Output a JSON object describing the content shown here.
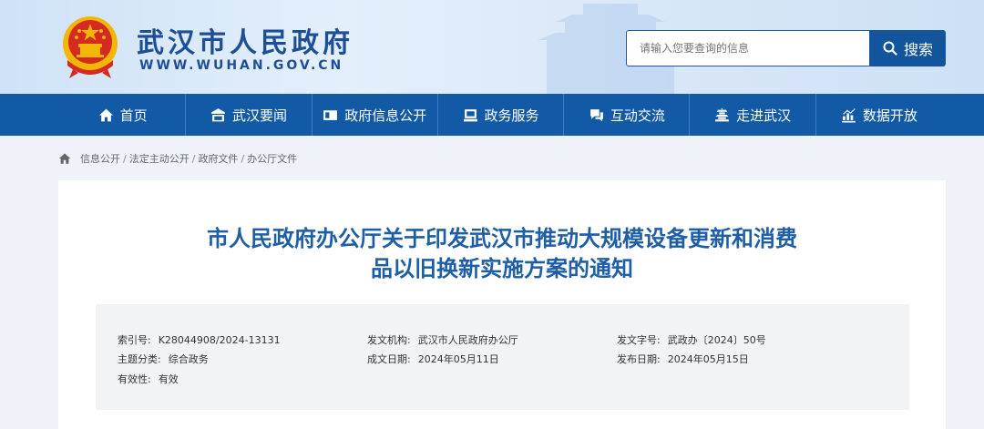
{
  "header": {
    "site_title": "武汉市人民政府",
    "site_url": "WWW.WUHAN.GOV.CN"
  },
  "search": {
    "placeholder": "请输入您要查询的信息",
    "button_label": "搜索",
    "icon": "search-icon"
  },
  "nav": {
    "items": [
      {
        "label": "首页",
        "icon": "home-icon"
      },
      {
        "label": "武汉要闻",
        "icon": "news-icon"
      },
      {
        "label": "政府信息公开",
        "icon": "info-card-icon"
      },
      {
        "label": "政务服务",
        "icon": "service-icon"
      },
      {
        "label": "互动交流",
        "icon": "chat-icon"
      },
      {
        "label": "走进武汉",
        "icon": "tower-icon"
      },
      {
        "label": "数据开放",
        "icon": "chart-icon"
      }
    ]
  },
  "breadcrumb": {
    "icon": "home-icon",
    "items": [
      "信息公开",
      "法定主动公开",
      "政府文件",
      "办公厅文件"
    ],
    "separator": "/"
  },
  "document": {
    "title_line1": "市人民政府办公厅关于印发武汉市推动大规模设备更新和消费",
    "title_line2": "品以旧换新实施方案的通知",
    "meta": {
      "index_label": "索引号:",
      "index_value": "K28044908/2024-13131",
      "issuer_label": "发文机构:",
      "issuer_value": "武汉市人民政府办公厅",
      "doc_no_label": "发文字号:",
      "doc_no_value": "武政办〔2024〕50号",
      "topic_label": "主题分类:",
      "topic_value": "综合政务",
      "created_label": "成文日期:",
      "created_value": "2024年05月11日",
      "published_label": "发布日期:",
      "published_value": "2024年05月15日",
      "validity_label": "有效性:",
      "validity_value": "有效"
    }
  },
  "colors": {
    "brand_blue": "#135aa6",
    "title_blue": "#1e5ea6",
    "emblem_red": "#d42a1f",
    "emblem_gold": "#f2b705"
  }
}
